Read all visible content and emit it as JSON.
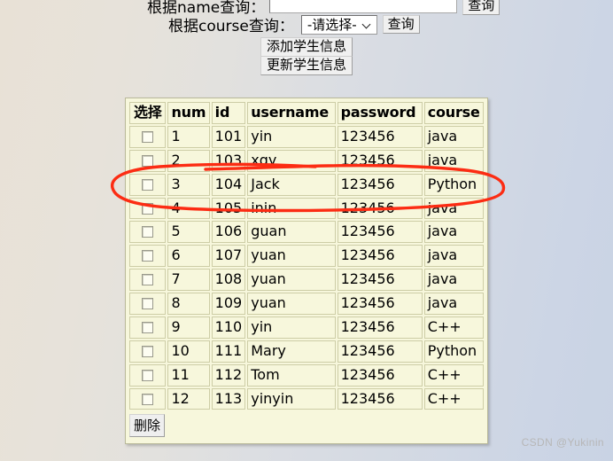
{
  "form": {
    "name_query_label": "根据name查询：",
    "name_query_value": "",
    "name_query_placeholder": "",
    "name_query_button": "查询",
    "course_query_label": "根据course查询：",
    "course_select_value": "-请选择-",
    "course_query_button": "查询",
    "add_student_button": "添加学生信息",
    "update_student_button": "更新学生信息"
  },
  "table": {
    "headers": [
      "选择",
      "num",
      "id",
      "username",
      "password",
      "course"
    ],
    "rows": [
      {
        "num": "1",
        "id": "101",
        "username": "yin",
        "password": "123456",
        "course": "java"
      },
      {
        "num": "2",
        "id": "103",
        "username": "xgy",
        "password": "123456",
        "course": "java"
      },
      {
        "num": "3",
        "id": "104",
        "username": "Jack",
        "password": "123456",
        "course": "Python"
      },
      {
        "num": "4",
        "id": "105",
        "username": "inin",
        "password": "123456",
        "course": "java"
      },
      {
        "num": "5",
        "id": "106",
        "username": "guan",
        "password": "123456",
        "course": "java"
      },
      {
        "num": "6",
        "id": "107",
        "username": "yuan",
        "password": "123456",
        "course": "java"
      },
      {
        "num": "7",
        "id": "108",
        "username": "yuan",
        "password": "123456",
        "course": "java"
      },
      {
        "num": "8",
        "id": "109",
        "username": "yuan",
        "password": "123456",
        "course": "java"
      },
      {
        "num": "9",
        "id": "110",
        "username": "yin",
        "password": "123456",
        "course": "C++"
      },
      {
        "num": "10",
        "id": "111",
        "username": "Mary",
        "password": "123456",
        "course": "Python"
      },
      {
        "num": "11",
        "id": "112",
        "username": "Tom",
        "password": "123456",
        "course": "C++"
      },
      {
        "num": "12",
        "id": "113",
        "username": "yinyin",
        "password": "123456",
        "course": "C++"
      }
    ],
    "delete_button": "删除"
  },
  "annotation": {
    "type": "hand-drawn-ellipse",
    "color": "#fc2c13",
    "target_row_num": "3"
  },
  "watermark": {
    "text": "CSDN @Yukinin"
  },
  "colors": {
    "table_background": "#f7f7dc",
    "table_border": "#cdcda6",
    "panel_border": "#b9b99a",
    "annotation_red": "#fc2c13",
    "watermark_gray": "#b7b7b7"
  }
}
